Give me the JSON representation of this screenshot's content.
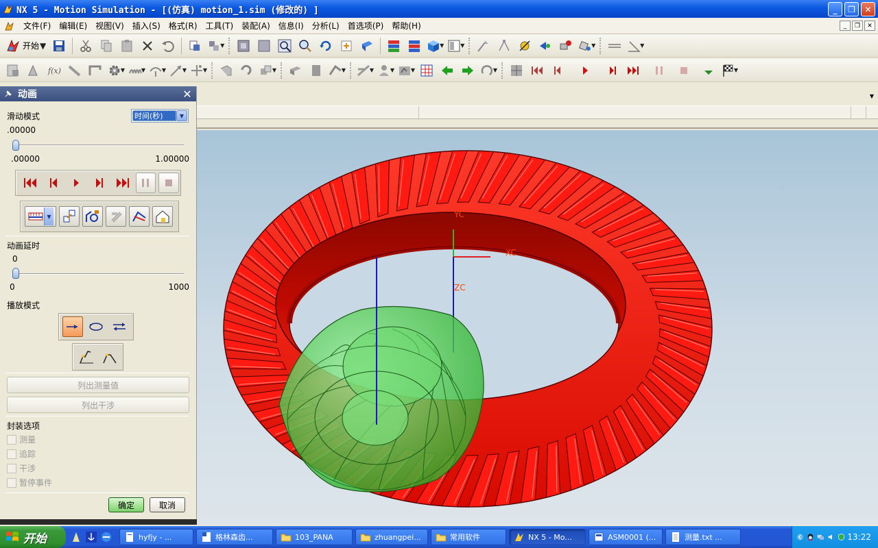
{
  "window": {
    "title": "NX 5 - Motion Simulation - [(仿真) motion_1.sim  (修改的) ]"
  },
  "menu": [
    "文件(F)",
    "编辑(E)",
    "视图(V)",
    "插入(S)",
    "格式(R)",
    "工具(T)",
    "装配(A)",
    "信息(I)",
    "分析(L)",
    "首选项(P)",
    "帮助(H)"
  ],
  "toolbar": {
    "start_label": "开始"
  },
  "dialog": {
    "title": "动画",
    "slider_mode_label": "滑动模式",
    "slider_mode_value": "时间(秒)",
    "time_current": ".00000",
    "time_min": ".00000",
    "time_max": "1.00000",
    "time_position": 0,
    "delay_label": "动画延时",
    "delay_current": "0",
    "delay_min": "0",
    "delay_max": "1000",
    "delay_position": 0,
    "play_mode_label": "播放模式",
    "list_measure_label": "列出测量值",
    "list_interference_label": "列出干涉",
    "package_options_label": "封装选项",
    "options": [
      {
        "label": "测量",
        "checked": false
      },
      {
        "label": "追踪",
        "checked": false
      },
      {
        "label": "干涉",
        "checked": false
      },
      {
        "label": "暂停事件",
        "checked": false
      }
    ],
    "ok_label": "确定",
    "cancel_label": "取消"
  },
  "viewport": {
    "axis_labels": {
      "yc": "YC",
      "xc": "XC",
      "zc": "ZC"
    },
    "gear_color": "#ff1a12",
    "pinion_color": "#55e055"
  },
  "taskbar": {
    "start_label": "开始",
    "tasks": [
      {
        "label": "hyfjy - ...",
        "active": false
      },
      {
        "label": "格林森齿...",
        "active": false
      },
      {
        "label": "103_PANA",
        "active": false
      },
      {
        "label": "zhuangpei...",
        "active": false
      },
      {
        "label": "常用软件",
        "active": false
      },
      {
        "label": "NX 5 - Mo...",
        "active": true
      },
      {
        "label": "ASM0001 (...",
        "active": false
      },
      {
        "label": "测量.txt ...",
        "active": false
      }
    ],
    "clock": "13:22"
  }
}
